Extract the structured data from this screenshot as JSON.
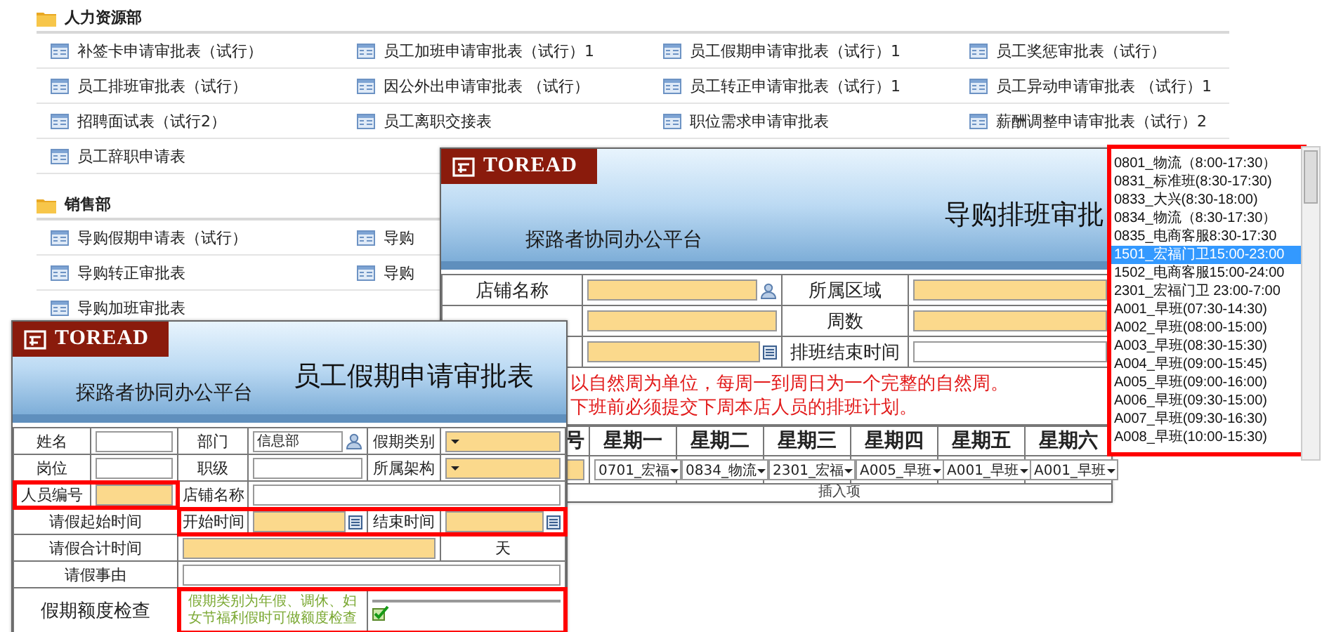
{
  "sections": [
    {
      "title": "人力资源部",
      "rows": [
        [
          "补签卡申请审批表（试行）",
          "员工加班申请审批表（试行）1",
          "员工假期申请审批表（试行）1",
          "员工奖惩审批表（试行）"
        ],
        [
          "员工排班审批表（试行）",
          "因公外出申请审批表 （试行）",
          "员工转正申请审批表（试行）1",
          "员工异动申请审批表 （试行）1"
        ],
        [
          "招聘面试表（试行2）",
          "员工离职交接表",
          "职位需求申请审批表",
          "薪酬调整申请审批表（试行）2"
        ],
        [
          "员工辞职申请表"
        ]
      ]
    },
    {
      "title": "销售部",
      "rows": [
        [
          "导购假期申请表（试行）",
          "导购"
        ],
        [
          "导购转正审批表",
          "导购"
        ],
        [
          "导购加班审批表"
        ]
      ]
    }
  ],
  "schedule_form": {
    "logo": "TOREAD",
    "platform": "探路者协同办公平台",
    "title": "导购排班审批",
    "store": {
      "label": "店铺名称"
    },
    "region": {
      "label": "所属区域"
    },
    "week": {
      "label": "周数"
    },
    "end_time": {
      "label": "排班结束时间"
    },
    "notice": [
      "以自然周为单位，每周一到周日为一个完整的自然周。",
      "下班前必须提交下周本店人员的排班计划。"
    ],
    "first_column": "号",
    "days": [
      {
        "day": "星期一",
        "shift": "0701_宏福"
      },
      {
        "day": "星期二",
        "shift": "0834_物流"
      },
      {
        "day": "星期三",
        "shift": "2301_宏福"
      },
      {
        "day": "星期四",
        "shift": "A005_早班"
      },
      {
        "day": "星期五",
        "shift": "A001_早班"
      },
      {
        "day": "星期六",
        "shift": "A001_早班"
      }
    ],
    "insert_label": "插入项"
  },
  "shift_dropdown": {
    "highlighted": true,
    "options": [
      {
        "label": "0801_物流（8:00-17:30）",
        "selected": false
      },
      {
        "label": "0831_标准班(8:30-17:30)",
        "selected": false
      },
      {
        "label": "0833_大兴(8:30-18:00)",
        "selected": false
      },
      {
        "label": "0834_物流（8:30-17:30）",
        "selected": false
      },
      {
        "label": "0835_电商客服8:30-17:30",
        "selected": false
      },
      {
        "label": "1501_宏福门卫15:00-23:00",
        "selected": true
      },
      {
        "label": "1502_电商客服15:00-24:00",
        "selected": false
      },
      {
        "label": "2301_宏福门卫 23:00-7:00",
        "selected": false
      },
      {
        "label": "A001_早班(07:30-14:30)",
        "selected": false
      },
      {
        "label": "A002_早班(08:00-15:00)",
        "selected": false
      },
      {
        "label": "A003_早班(08:30-15:30)",
        "selected": false
      },
      {
        "label": "A004_早班(09:00-15:45)",
        "selected": false
      },
      {
        "label": "A005_早班(09:00-16:00)",
        "selected": false
      },
      {
        "label": "A006_早班(09:30-15:00)",
        "selected": false
      },
      {
        "label": "A007_早班(09:30-16:30)",
        "selected": false
      },
      {
        "label": "A008_早班(10:00-15:30)",
        "selected": false
      }
    ]
  },
  "leave_form": {
    "logo": "TOREAD",
    "platform": "探路者协同办公平台",
    "title": "员工假期申请审批表",
    "name": {
      "label": "姓名"
    },
    "department": {
      "label": "部门",
      "value": "信息部"
    },
    "leave_type": {
      "label": "假期类别"
    },
    "position": {
      "label": "岗位"
    },
    "rank": {
      "label": "职级"
    },
    "organization": {
      "label": "所属架构"
    },
    "employee_no": {
      "label": "人员编号",
      "highlighted": true
    },
    "store": {
      "label": "店铺名称"
    },
    "period": {
      "label": "请假起始时间",
      "start_label": "开始时间",
      "end_label": "结束时间",
      "highlighted": true
    },
    "total": {
      "label": "请假合计时间",
      "unit": "天"
    },
    "reason": {
      "label": "请假事由"
    },
    "quota": {
      "label": "假期额度检查",
      "note": "假期类别为年假、调休、妇女节福利假时可做额度检查",
      "highlighted": true
    }
  }
}
